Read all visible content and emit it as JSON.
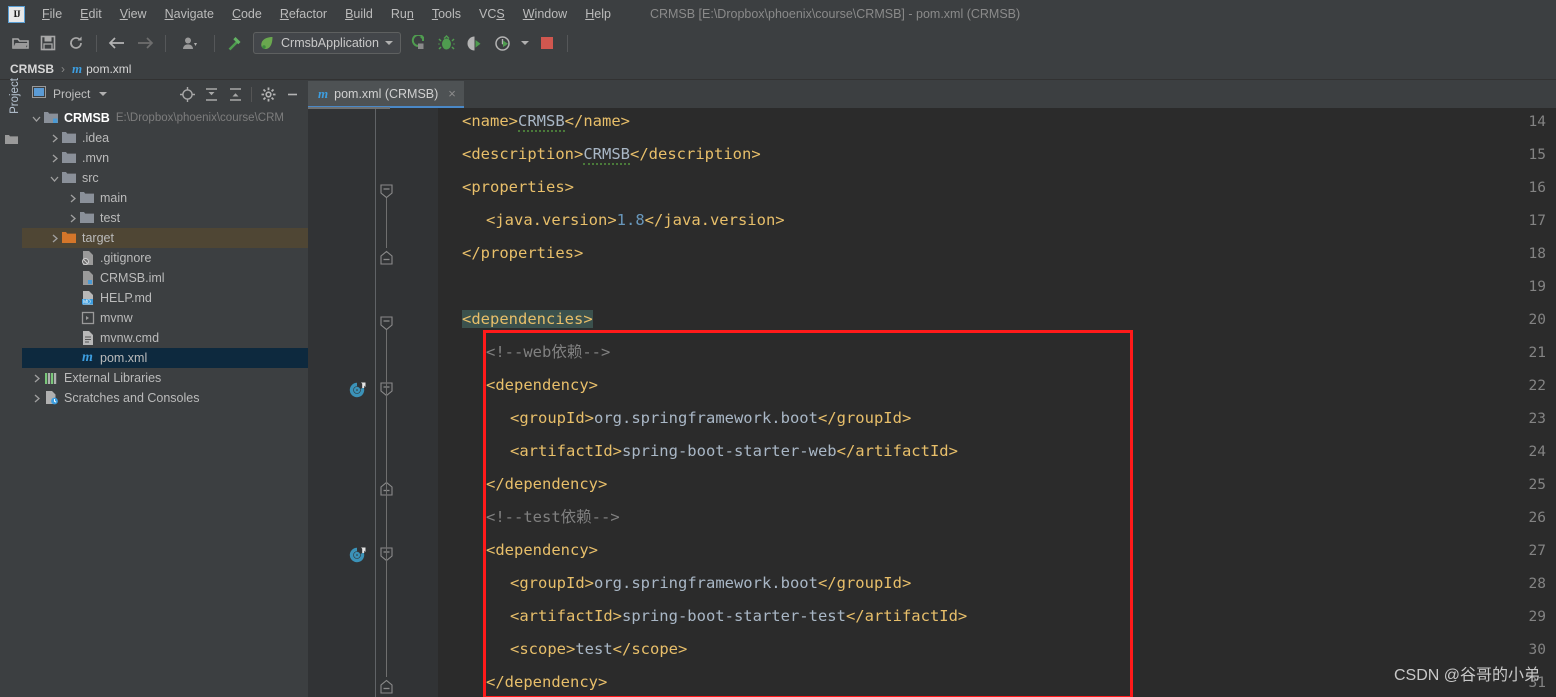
{
  "window": {
    "title": "CRMSB [E:\\Dropbox\\phoenix\\course\\CRMSB] - pom.xml (CRMSB)",
    "logo": "intellij-idea-logo"
  },
  "menubar": {
    "items": [
      {
        "label": "File",
        "mnemonic": "F"
      },
      {
        "label": "Edit",
        "mnemonic": "E"
      },
      {
        "label": "View",
        "mnemonic": "V"
      },
      {
        "label": "Navigate",
        "mnemonic": "N"
      },
      {
        "label": "Code",
        "mnemonic": "C"
      },
      {
        "label": "Refactor",
        "mnemonic": "R"
      },
      {
        "label": "Build",
        "mnemonic": "B"
      },
      {
        "label": "Run",
        "mnemonic": "n"
      },
      {
        "label": "Tools",
        "mnemonic": "T"
      },
      {
        "label": "VCS",
        "mnemonic": "S"
      },
      {
        "label": "Window",
        "mnemonic": "W"
      },
      {
        "label": "Help",
        "mnemonic": "H"
      }
    ]
  },
  "toolbar": {
    "open_label": "open-folder-icon",
    "save_label": "save-icon",
    "sync_label": "sync-icon",
    "back_label": "back-arrow-icon",
    "forward_label": "forward-arrow-icon",
    "profile_label": "user-profile-icon",
    "build_label": "build-hammer-icon",
    "run_config": "CrmsbApplication",
    "run_label": "run-icon",
    "debug_label": "debug-icon",
    "coverage_label": "run-with-coverage-icon",
    "profile_run_label": "profiler-icon",
    "stop_label": "stop-icon"
  },
  "breadcrumb": {
    "root": "CRMSB",
    "separator": "›",
    "file_badge": "m",
    "file": "pom.xml"
  },
  "leftstrip": {
    "project_tab": "Project"
  },
  "project_panel": {
    "title": "Project",
    "tools": [
      {
        "name": "locate-target-icon"
      },
      {
        "name": "expand-all-icon"
      },
      {
        "name": "collapse-all-icon"
      },
      {
        "name": "settings-gear-icon"
      },
      {
        "name": "minimize-icon"
      }
    ],
    "tree": [
      {
        "label": "CRMSB",
        "path": "E:\\Dropbox\\phoenix\\course\\CRM",
        "indent": 0,
        "arrow": "down",
        "icon": "module-folder-icon",
        "state": "root"
      },
      {
        "label": ".idea",
        "path": "",
        "indent": 1,
        "arrow": "right",
        "icon": "folder-icon",
        "state": "none"
      },
      {
        "label": ".mvn",
        "path": "",
        "indent": 1,
        "arrow": "right",
        "icon": "folder-icon",
        "state": "none"
      },
      {
        "label": "src",
        "path": "",
        "indent": 1,
        "arrow": "down",
        "icon": "folder-icon",
        "state": "none"
      },
      {
        "label": "main",
        "path": "",
        "indent": 2,
        "arrow": "right",
        "icon": "folder-icon",
        "state": "none"
      },
      {
        "label": "test",
        "path": "",
        "indent": 2,
        "arrow": "right",
        "icon": "folder-icon",
        "state": "none"
      },
      {
        "label": "target",
        "path": "",
        "indent": 1,
        "arrow": "right",
        "icon": "excluded-folder-icon",
        "state": "tan"
      },
      {
        "label": ".gitignore",
        "path": "",
        "indent": 2,
        "arrow": "none",
        "icon": "gitignore-file-icon",
        "state": "none"
      },
      {
        "label": "CRMSB.iml",
        "path": "",
        "indent": 2,
        "arrow": "none",
        "icon": "iml-file-icon",
        "state": "none"
      },
      {
        "label": "HELP.md",
        "path": "",
        "indent": 2,
        "arrow": "none",
        "icon": "markdown-file-icon",
        "state": "none"
      },
      {
        "label": "mvnw",
        "path": "",
        "indent": 2,
        "arrow": "none",
        "icon": "script-file-icon",
        "state": "none"
      },
      {
        "label": "mvnw.cmd",
        "path": "",
        "indent": 2,
        "arrow": "none",
        "icon": "cmd-file-icon",
        "state": "none"
      },
      {
        "label": "pom.xml",
        "path": "",
        "indent": 2,
        "arrow": "none",
        "icon": "maven-file-icon",
        "state": "blue"
      },
      {
        "label": "External Libraries",
        "path": "",
        "indent": 0,
        "arrow": "right",
        "icon": "libraries-icon",
        "state": "none"
      },
      {
        "label": "Scratches and Consoles",
        "path": "",
        "indent": 0,
        "arrow": "right",
        "icon": "scratches-icon",
        "state": "none"
      }
    ]
  },
  "editor": {
    "tab": {
      "badge": "m",
      "label": "pom.xml (CRMSB)",
      "close": "×"
    },
    "first_line": 14,
    "lines": [
      {
        "n": 14,
        "indent": 1,
        "fold": "none",
        "mvn": false,
        "segments": [
          {
            "t": "<name>",
            "c": "tag"
          },
          {
            "t": "CRMSB",
            "c": "val squig"
          },
          {
            "t": "</name>",
            "c": "tag"
          }
        ]
      },
      {
        "n": 15,
        "indent": 1,
        "fold": "none",
        "mvn": false,
        "segments": [
          {
            "t": "<description>",
            "c": "tag"
          },
          {
            "t": "CRMSB",
            "c": "val squig"
          },
          {
            "t": "</description>",
            "c": "tag"
          }
        ]
      },
      {
        "n": 16,
        "indent": 1,
        "fold": "open",
        "mvn": false,
        "segments": [
          {
            "t": "<properties>",
            "c": "tag"
          }
        ]
      },
      {
        "n": 17,
        "indent": 2,
        "fold": "none",
        "mvn": false,
        "segments": [
          {
            "t": "<java.version>",
            "c": "tag"
          },
          {
            "t": "1.8",
            "c": "num"
          },
          {
            "t": "</java.version>",
            "c": "tag"
          }
        ]
      },
      {
        "n": 18,
        "indent": 1,
        "fold": "close",
        "mvn": false,
        "segments": [
          {
            "t": "</properties>",
            "c": "tag"
          }
        ]
      },
      {
        "n": 19,
        "indent": 1,
        "fold": "none",
        "mvn": false,
        "segments": []
      },
      {
        "n": 20,
        "indent": 1,
        "fold": "open",
        "mvn": false,
        "segments": [
          {
            "t": "<dependencies>",
            "c": "tag hl"
          }
        ]
      },
      {
        "n": 21,
        "indent": 2,
        "fold": "none",
        "mvn": false,
        "segments": [
          {
            "t": "<!--web依赖-->",
            "c": "cmt"
          }
        ]
      },
      {
        "n": 22,
        "indent": 2,
        "fold": "open",
        "mvn": true,
        "segments": [
          {
            "t": "<dependency>",
            "c": "tag"
          }
        ]
      },
      {
        "n": 23,
        "indent": 3,
        "fold": "none",
        "mvn": false,
        "segments": [
          {
            "t": "<groupId>",
            "c": "tag"
          },
          {
            "t": "org.springframework.boot",
            "c": "val"
          },
          {
            "t": "</groupId>",
            "c": "tag"
          }
        ]
      },
      {
        "n": 24,
        "indent": 3,
        "fold": "none",
        "mvn": false,
        "segments": [
          {
            "t": "<artifactId>",
            "c": "tag"
          },
          {
            "t": "spring-boot-starter-web",
            "c": "val"
          },
          {
            "t": "</artifactId>",
            "c": "tag"
          }
        ]
      },
      {
        "n": 25,
        "indent": 2,
        "fold": "close",
        "mvn": false,
        "segments": [
          {
            "t": "</dependency>",
            "c": "tag"
          }
        ]
      },
      {
        "n": 26,
        "indent": 2,
        "fold": "none",
        "mvn": false,
        "segments": [
          {
            "t": "<!--test依赖-->",
            "c": "cmt"
          }
        ]
      },
      {
        "n": 27,
        "indent": 2,
        "fold": "open",
        "mvn": true,
        "segments": [
          {
            "t": "<dependency>",
            "c": "tag"
          }
        ]
      },
      {
        "n": 28,
        "indent": 3,
        "fold": "none",
        "mvn": false,
        "segments": [
          {
            "t": "<groupId>",
            "c": "tag"
          },
          {
            "t": "org.springframework.boot",
            "c": "val"
          },
          {
            "t": "</groupId>",
            "c": "tag"
          }
        ]
      },
      {
        "n": 29,
        "indent": 3,
        "fold": "none",
        "mvn": false,
        "segments": [
          {
            "t": "<artifactId>",
            "c": "tag"
          },
          {
            "t": "spring-boot-starter-test",
            "c": "val"
          },
          {
            "t": "</artifactId>",
            "c": "tag"
          }
        ]
      },
      {
        "n": 30,
        "indent": 3,
        "fold": "none",
        "mvn": false,
        "segments": [
          {
            "t": "<scope>",
            "c": "tag"
          },
          {
            "t": "test",
            "c": "val"
          },
          {
            "t": "</scope>",
            "c": "tag"
          }
        ]
      },
      {
        "n": 31,
        "indent": 2,
        "fold": "close",
        "mvn": false,
        "segments": [
          {
            "t": "</dependency>",
            "c": "tag"
          }
        ]
      }
    ]
  },
  "annotation": {
    "box_color": "#ff1a1a"
  },
  "watermark": {
    "text": "CSDN @谷哥的小弟"
  },
  "colors": {
    "editor_bg": "#2b2b2b",
    "gutter_bg": "#313335",
    "panel_bg": "#3c3f41",
    "tag": "#e8bf6a",
    "value": "#a9b7c6",
    "number": "#6897bb",
    "comment": "#808080",
    "selection_blue": "#0d293e",
    "accent_blue": "#4a88c7"
  }
}
